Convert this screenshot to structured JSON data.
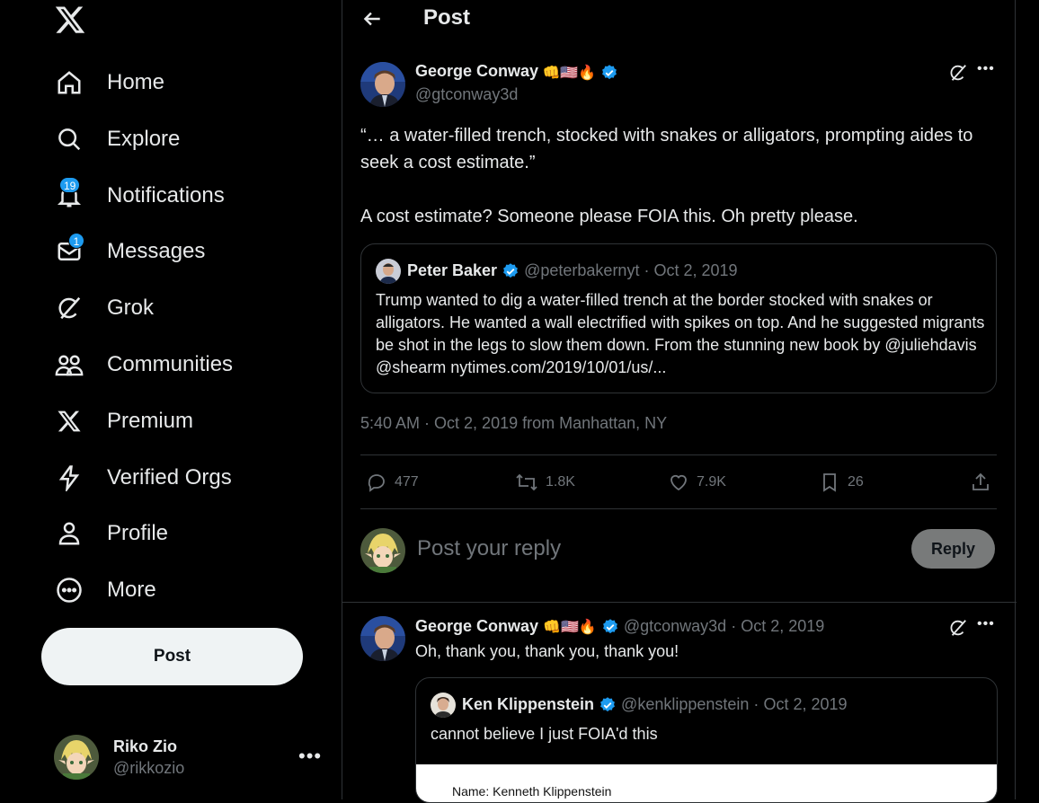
{
  "nav": {
    "items": [
      {
        "label": "Home",
        "icon": "home-icon"
      },
      {
        "label": "Explore",
        "icon": "search-icon"
      },
      {
        "label": "Notifications",
        "icon": "bell-icon",
        "badge": "19"
      },
      {
        "label": "Messages",
        "icon": "mail-icon",
        "badge": "1"
      },
      {
        "label": "Grok",
        "icon": "grok-icon"
      },
      {
        "label": "Communities",
        "icon": "communities-icon"
      },
      {
        "label": "Premium",
        "icon": "x-icon"
      },
      {
        "label": "Verified Orgs",
        "icon": "lightning-icon"
      },
      {
        "label": "Profile",
        "icon": "person-icon"
      },
      {
        "label": "More",
        "icon": "more-circle-icon"
      }
    ],
    "post_button": "Post"
  },
  "account": {
    "name": "Riko Zio",
    "handle": "@rikkozio"
  },
  "header": {
    "title": "Post"
  },
  "tweet": {
    "author": "George Conway",
    "emojis": "👊🇺🇸🔥",
    "handle": "@gtconway3d",
    "text_line1": "“… a water-filled trench, stocked with snakes or alligators, prompting aides to seek a cost estimate.”",
    "text_line2": "A cost estimate?  Someone please FOIA this.  Oh pretty please.",
    "quote": {
      "author": "Peter Baker",
      "handle": "@peterbakernyt",
      "date": "Oct 2, 2019",
      "text": "Trump wanted to dig a water-filled trench at the border stocked with snakes or alligators. He wanted a wall electrified with spikes on top. And he suggested migrants be shot in the legs to slow them down. From the stunning new book by @juliehdavis @shearm nytimes.com/2019/10/01/us/..."
    },
    "timestamp": "5:40 AM · Oct 2, 2019 from Manhattan, NY",
    "metrics": {
      "replies": "477",
      "reposts": "1.8K",
      "likes": "7.9K",
      "bookmarks": "26"
    }
  },
  "reply_box": {
    "placeholder": "Post your reply",
    "button": "Reply"
  },
  "reply": {
    "author": "George Conway",
    "emojis": "👊🇺🇸🔥",
    "handle": "@gtconway3d",
    "date": "Oct 2, 2019",
    "text": "Oh, thank you, thank you, thank you!",
    "quote": {
      "author": "Ken Klippenstein",
      "handle": "@kenklippenstein",
      "date": "Oct 2, 2019",
      "text": "cannot believe I just FOIA'd this",
      "image_text": "Name: Kenneth Klippenstein"
    }
  },
  "colors": {
    "accent": "#1d9bf0",
    "muted": "#71767b",
    "border": "#2f3336"
  }
}
